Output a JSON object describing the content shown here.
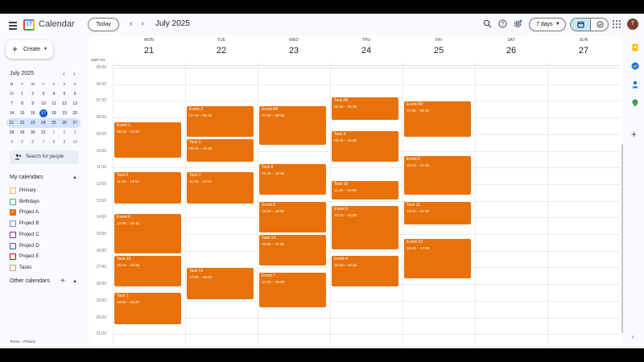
{
  "header": {
    "app_title": "Calendar",
    "logo_text": "17",
    "today_label": "Today",
    "prev_arrow": "‹",
    "next_arrow": "›",
    "current_month": "July 2025",
    "view_label": "7 days",
    "avatar_initial": "T"
  },
  "sidebar": {
    "create_label": "Create",
    "mini_month": "July 2025",
    "mini_days_of_week": [
      "M",
      "T",
      "W",
      "T",
      "F",
      "S",
      "S"
    ],
    "mini_weeks": [
      [
        "30",
        "1",
        "2",
        "3",
        "4",
        "5",
        "6"
      ],
      [
        "7",
        "8",
        "9",
        "10",
        "11",
        "12",
        "13"
      ],
      [
        "14",
        "15",
        "16",
        "17",
        "18",
        "19",
        "20"
      ],
      [
        "21",
        "22",
        "23",
        "24",
        "25",
        "26",
        "27"
      ],
      [
        "28",
        "29",
        "30",
        "31",
        "1",
        "2",
        "3"
      ],
      [
        "4",
        "5",
        "6",
        "7",
        "8",
        "9",
        "10"
      ]
    ],
    "search_people": "Search for people",
    "my_calendars_title": "My calendars",
    "calendars": [
      {
        "label": "Primary",
        "color": "#f6bf26",
        "checked": false
      },
      {
        "label": "Birthdays",
        "color": "#33b679",
        "checked": false
      },
      {
        "label": "Project A",
        "color": "#e8710a",
        "checked": true
      },
      {
        "label": "Project B",
        "color": "#7986cb",
        "checked": false
      },
      {
        "label": "Project C",
        "color": "#8e24aa",
        "checked": false
      },
      {
        "label": "Project D",
        "color": "#3f51b5",
        "checked": false
      },
      {
        "label": "Project E",
        "color": "#d50000",
        "checked": false
      },
      {
        "label": "Tasks",
        "color": "#d0a36b",
        "checked": false
      }
    ],
    "other_calendars_title": "Other calendars",
    "footer": "Terms – Privacy"
  },
  "week": {
    "timezone": "GMT+07",
    "days": [
      {
        "dow": "MON",
        "num": "21"
      },
      {
        "dow": "TUE",
        "num": "22"
      },
      {
        "dow": "WED",
        "num": "23"
      },
      {
        "dow": "THU",
        "num": "24"
      },
      {
        "dow": "FRI",
        "num": "25"
      },
      {
        "dow": "SAT",
        "num": "26"
      },
      {
        "dow": "SUN",
        "num": "27"
      }
    ],
    "hours": [
      "05:00",
      "06:00",
      "07:00",
      "08:00",
      "09:00",
      "10:00",
      "11:00",
      "12:00",
      "13:00",
      "14:00",
      "15:00",
      "16:00",
      "17:00",
      "18:00",
      "19:00",
      "20:00",
      "21:00"
    ],
    "first_hour": 5,
    "event_color": "#e8710a",
    "events": [
      {
        "day": 0,
        "title": "Event 1",
        "time": "08:15 – 10:30",
        "start": "08:15",
        "end": "10:30"
      },
      {
        "day": 0,
        "title": "Task 6",
        "time": "11:15 – 13:15",
        "start": "11:15",
        "end": "13:15"
      },
      {
        "day": 0,
        "title": "Event 6",
        "time": "13:45 – 16:15",
        "start": "13:45",
        "end": "16:15"
      },
      {
        "day": 0,
        "title": "Task 12",
        "time": "16:15 – 18:15",
        "start": "16:15",
        "end": "18:15"
      },
      {
        "day": 0,
        "title": "Task 1",
        "time": "18:30 – 20:30",
        "start": "18:30",
        "end": "20:30"
      },
      {
        "day": 1,
        "title": "Event 2",
        "time": "07:15 – 09:15",
        "start": "07:15",
        "end": "09:15"
      },
      {
        "day": 1,
        "title": "Task 2",
        "time": "09:15 – 10:45",
        "start": "09:15",
        "end": "10:45"
      },
      {
        "day": 1,
        "title": "Task 7",
        "time": "11:15 – 13:15",
        "start": "11:15",
        "end": "13:15"
      },
      {
        "day": 1,
        "title": "Task 13",
        "time": "17:00 – 19:00",
        "start": "17:00",
        "end": "19:00"
      },
      {
        "day": 2,
        "title": "Event A8",
        "time": "07:15 – 09:45",
        "start": "07:15",
        "end": "09:45"
      },
      {
        "day": 2,
        "title": "Task 8",
        "time": "10:45 – 12:45",
        "start": "10:45",
        "end": "12:45"
      },
      {
        "day": 2,
        "title": "Event 8",
        "time": "13:00 – 15:00",
        "start": "13:00",
        "end": "15:00"
      },
      {
        "day": 2,
        "title": "Task 14",
        "time": "15:00 – 17:00",
        "start": "15:00",
        "end": "17:00"
      },
      {
        "day": 2,
        "title": "Event 7",
        "time": "17:15 – 19:30",
        "start": "17:15",
        "end": "19:30"
      },
      {
        "day": 3,
        "title": "Task A6",
        "time": "06:45 – 08:15",
        "start": "06:45",
        "end": "08:15"
      },
      {
        "day": 3,
        "title": "Task 4",
        "time": "08:45 – 10:45",
        "start": "08:45",
        "end": "10:45"
      },
      {
        "day": 3,
        "title": "Task 10",
        "time": "11:45 – 13:00",
        "start": "11:45",
        "end": "13:00"
      },
      {
        "day": 3,
        "title": "Event 9",
        "time": "13:15 – 16:00",
        "start": "13:15",
        "end": "16:00"
      },
      {
        "day": 3,
        "title": "Event 4",
        "time": "16:15 – 18:15",
        "start": "16:15",
        "end": "18:15"
      },
      {
        "day": 4,
        "title": "Event A9",
        "time": "07:00 – 09:15",
        "start": "07:00",
        "end": "09:15"
      },
      {
        "day": 4,
        "title": "Event 5",
        "time": "10:15 – 12:45",
        "start": "10:15",
        "end": "12:45"
      },
      {
        "day": 4,
        "title": "Task 11",
        "time": "13:00 – 14:30",
        "start": "13:00",
        "end": "14:30"
      },
      {
        "day": 4,
        "title": "Event 10",
        "time": "15:15 – 17:45",
        "start": "15:15",
        "end": "17:45"
      }
    ]
  }
}
